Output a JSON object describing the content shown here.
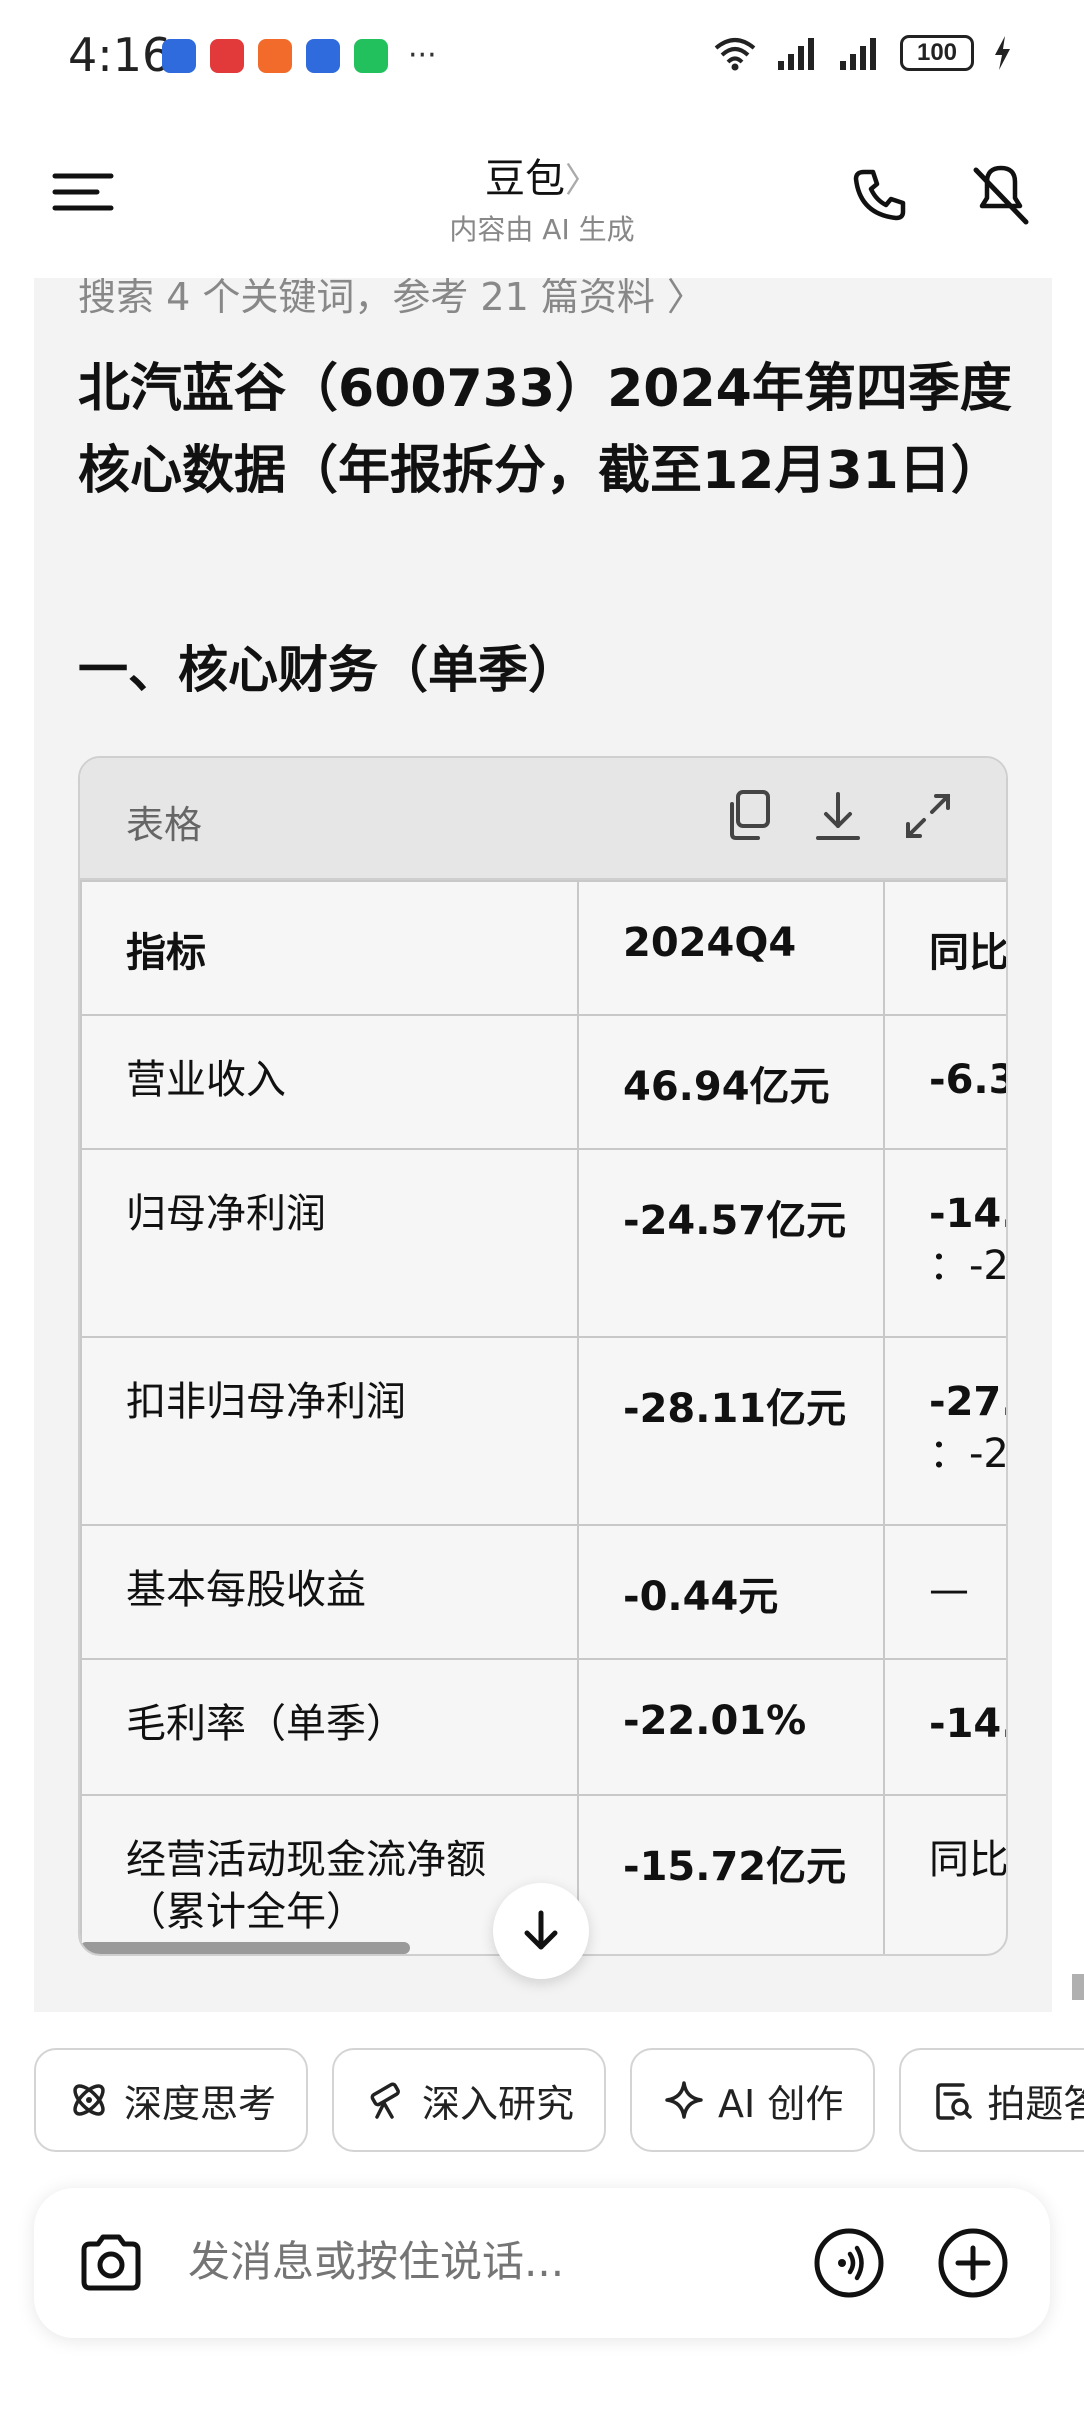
{
  "status_bar": {
    "time": "4:16",
    "overflow": "···",
    "battery": "100",
    "icons": [
      "app-icon",
      "app-icon",
      "app-icon",
      "app-icon",
      "wechat-icon",
      "wifi-icon",
      "signal-icon",
      "signal-icon",
      "battery-icon",
      "charging-icon"
    ]
  },
  "header": {
    "title": "豆包",
    "title_chevron": "〉",
    "subtitle": "内容由 AI 生成",
    "icons": [
      "menu-icon",
      "phone-icon",
      "mute-icon"
    ]
  },
  "content": {
    "search_line": "搜索 4 个关键词，参考 21 篇资料 〉",
    "heading": "北汽蓝谷（600733）2024年第四季度核心数据（年报拆分，截至12月31日）",
    "section_title": "一、核心财务（单季）",
    "table": {
      "label": "表格",
      "toolbar_icons": [
        "copy-icon",
        "download-icon",
        "expand-icon"
      ],
      "columns": [
        "指标",
        "2024Q4",
        "同比"
      ],
      "rows": [
        {
          "metric": "营业收入",
          "value": "46.94亿元",
          "change": "-6.3"
        },
        {
          "metric": "归母净利润",
          "value": "-24.57亿元",
          "change": "-14.",
          "change_line2": "：-2"
        },
        {
          "metric": "扣非归母净利润",
          "value": "-28.11亿元",
          "change": "-27.",
          "change_line2": "：-2"
        },
        {
          "metric": "基本每股收益",
          "value": "-0.44元",
          "change": "—"
        },
        {
          "metric": "毛利率（单季）",
          "value": "-22.01%",
          "change": "-14."
        },
        {
          "metric": "经营活动现金流净额（累计全年）",
          "value": "-15.72亿元",
          "change": "同比"
        }
      ]
    }
  },
  "chips": [
    {
      "label": "深度思考",
      "icon": "atom-icon"
    },
    {
      "label": "深入研究",
      "icon": "telescope-icon"
    },
    {
      "label": "AI 创作",
      "icon": "sparkle-icon"
    },
    {
      "label": "拍题答",
      "icon": "photo-question-icon"
    }
  ],
  "input": {
    "placeholder": "发消息或按住说话...",
    "icons": [
      "camera-icon",
      "voice-icon",
      "plus-icon"
    ]
  },
  "colors": {
    "card_bg": "#f3f3f3",
    "table_header_bg": "#e6e6e6",
    "text": "#111111",
    "muted": "#888888"
  }
}
